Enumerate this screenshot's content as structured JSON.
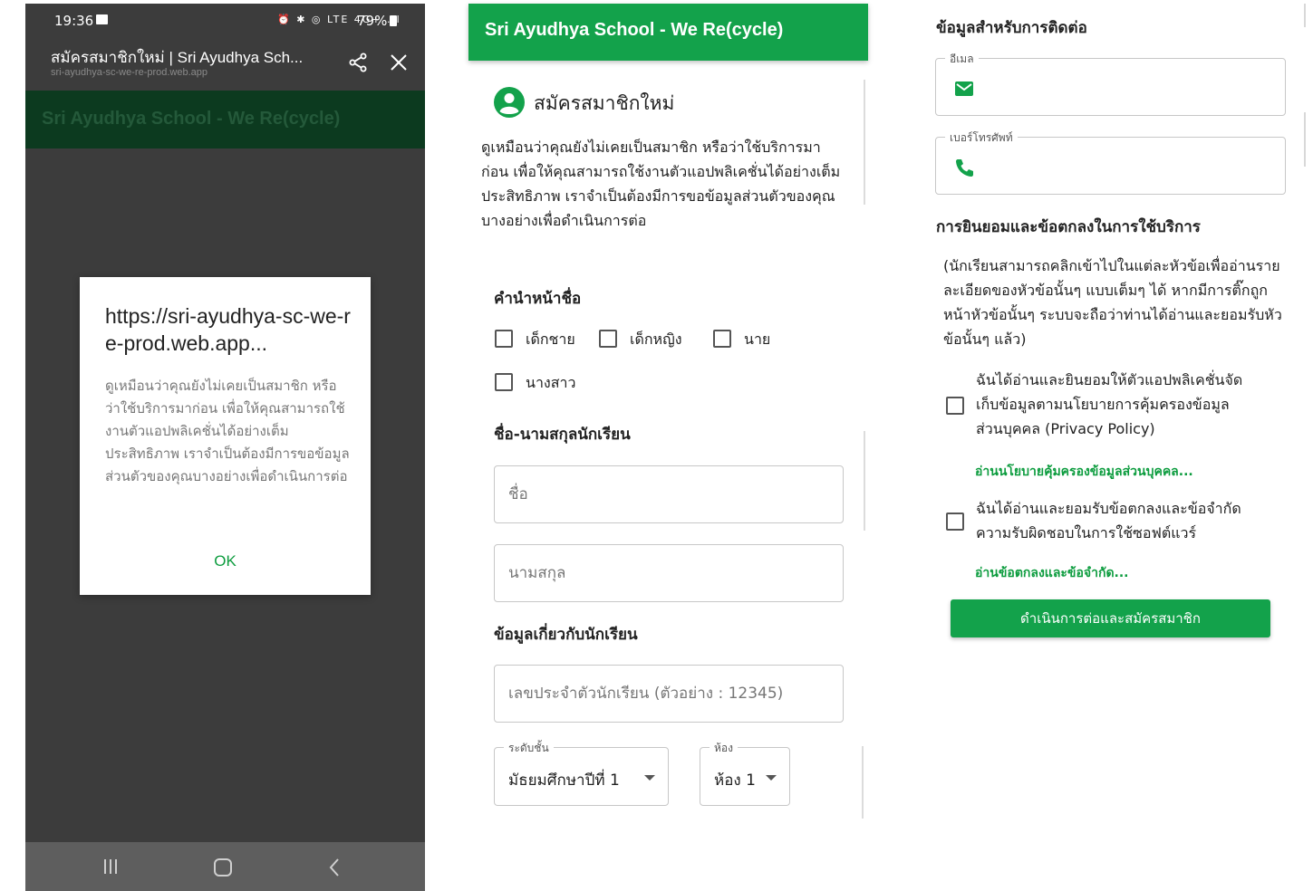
{
  "phone": {
    "status": {
      "time": "19:36",
      "indicators": "⏰ ✱ ◎ LTE 4G+ .ıl",
      "battery": "79%"
    },
    "browser": {
      "title": "สมัครสมาชิกใหม่ | Sri Ayudhya Sch...",
      "url": "sri-ayudhya-sc-we-re-prod.web.app"
    },
    "app_header": "Sri Ayudhya School - We Re(cycle)",
    "dialog": {
      "title": "https://sri-ayudhya-sc-we-re-prod.web.app...",
      "body": "ดูเหมือนว่าคุณยังไม่เคยเป็นสมาชิก หรือว่าใช้บริการมาก่อน เพื่อให้คุณสามารถใช้งานตัวแอปพลิเคชั่นได้อย่างเต็มประสิทธิภาพ เราจำเป็นต้องมีการขอข้อมูลส่วนตัวของคุณบางอย่างเพื่อดำเนินการต่อ",
      "ok": "OK"
    }
  },
  "form": {
    "app_title": "Sri Ayudhya School - We Re(cycle)",
    "title": "สมัครสมาชิกใหม่",
    "intro": "ดูเหมือนว่าคุณยังไม่เคยเป็นสมาชิก หรือว่าใช้บริการมาก่อน เพื่อให้คุณสามารถใช้งานตัวแอปพลิเคชั่นได้อย่างเต็มประสิทธิภาพ เราจำเป็นต้องมีการขอข้อมูลส่วนตัวของคุณบางอย่างเพื่อดำเนินการต่อ",
    "prefix_heading": "คำนำหน้าชื่อ",
    "prefixes": [
      "เด็กชาย",
      "เด็กหญิง",
      "นาย",
      "นางสาว"
    ],
    "name_heading": "ชื่อ-นามสกุลนักเรียน",
    "first_name_placeholder": "ชื่อ",
    "last_name_placeholder": "นามสกุล",
    "student_heading": "ข้อมูลเกี่ยวกับนักเรียน",
    "student_id_placeholder": "เลขประจำตัวนักเรียน (ตัวอย่าง : 12345)",
    "grade_label": "ระดับชั้น",
    "grade_value": "มัธยมศึกษาปีที่ 1",
    "room_label": "ห้อง",
    "room_value": "ห้อง 1"
  },
  "contact": {
    "heading": "ข้อมูลสำหรับการติดต่อ",
    "email_label": "อีเมล",
    "phone_label": "เบอร์โทรศัพท์",
    "terms_heading": "การยินยอมและข้อตกลงในการใช้บริการ",
    "terms_note": "(นักเรียนสามารถคลิกเข้าไปในแต่ละหัวข้อเพื่ออ่านรายละเอียดของหัวข้อนั้นๆ แบบเต็มๆ ได้ หากมีการติ๊กถูกหน้าหัวข้อนั้นๆ ระบบจะถือว่าท่านได้อ่านและยอมรับหัวข้อนั้นๆ แล้ว)",
    "privacy_consent": "ฉันได้อ่านและยินยอมให้ตัวแอปพลิเคชั่นจัดเก็บข้อมูลตามนโยบายการคุ้มครองข้อมูลส่วนบุคคล (Privacy Policy)",
    "privacy_link": "อ่านนโยบายคุ้มครองข้อมูลส่วนบุคคล...",
    "terms_consent": "ฉันได้อ่านและยอมรับข้อตกลงและข้อจำกัดความรับผิดชอบในการใช้ซอฟต์แวร์",
    "terms_link": "อ่านข้อตกลงและข้อจำกัด...",
    "submit": "ดำเนินการต่อและสมัครสมาชิก"
  },
  "colors": {
    "brand_green": "#13a24b",
    "link_green": "#0c9c3e"
  }
}
